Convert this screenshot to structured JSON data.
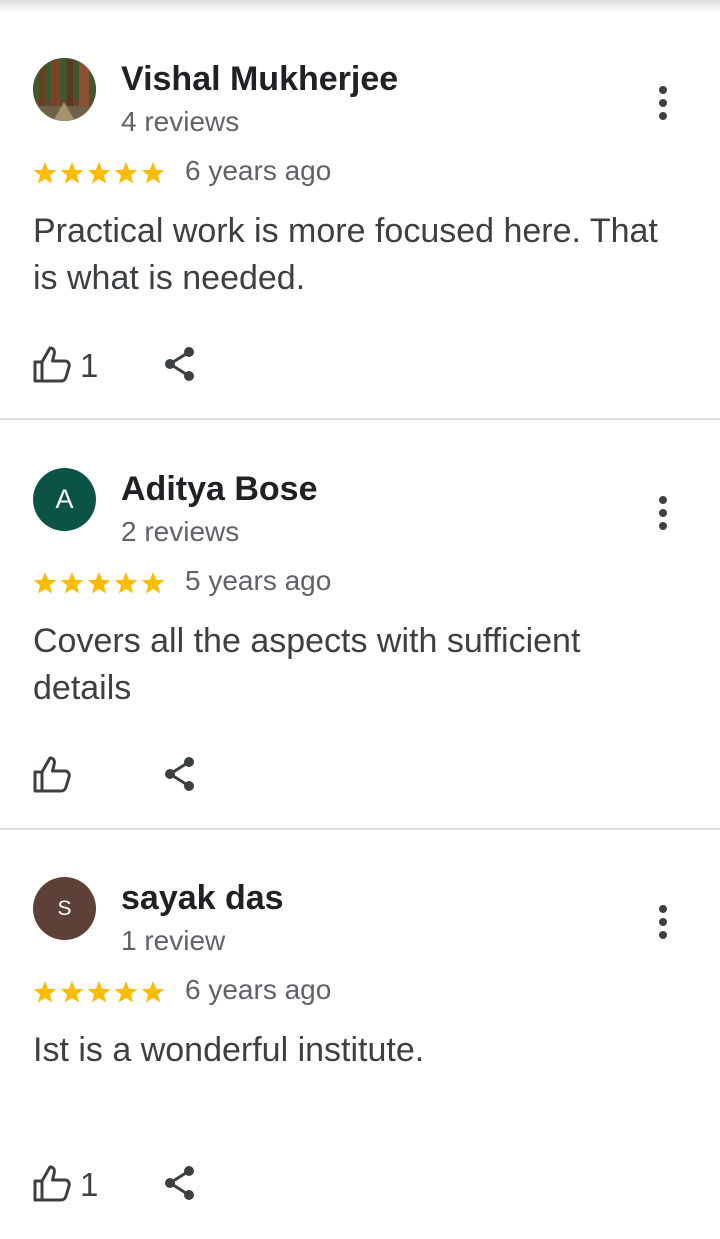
{
  "reviews": [
    {
      "name": "Vishal Mukherjee",
      "review_count": "4 reviews",
      "rating": 5,
      "time": "6 years ago",
      "text": "Practical work is more focused here. That is what is needed.",
      "likes": "1",
      "avatar": {
        "type": "photo",
        "letter": "",
        "color": "#4a3a2a"
      }
    },
    {
      "name": "Aditya Bose",
      "review_count": "2 reviews",
      "rating": 5,
      "time": "5 years ago",
      "text": "Covers all the aspects with sufficient details",
      "likes": "",
      "avatar": {
        "type": "letter",
        "letter": "A",
        "color": "#0b5345"
      }
    },
    {
      "name": "sayak das",
      "review_count": "1 review",
      "rating": 5,
      "time": "6 years ago",
      "text": "Ist is a wonderful institute.",
      "likes": "1",
      "avatar": {
        "type": "letter",
        "letter": "S",
        "color": "#5d4037"
      }
    }
  ],
  "colors": {
    "star": "#fbbc04",
    "icon": "#3c4043",
    "divider": "#dadce0"
  },
  "icons": {
    "more": "more-vert-icon",
    "like": "thumbs-up-icon",
    "share": "share-icon",
    "star": "star-icon"
  }
}
